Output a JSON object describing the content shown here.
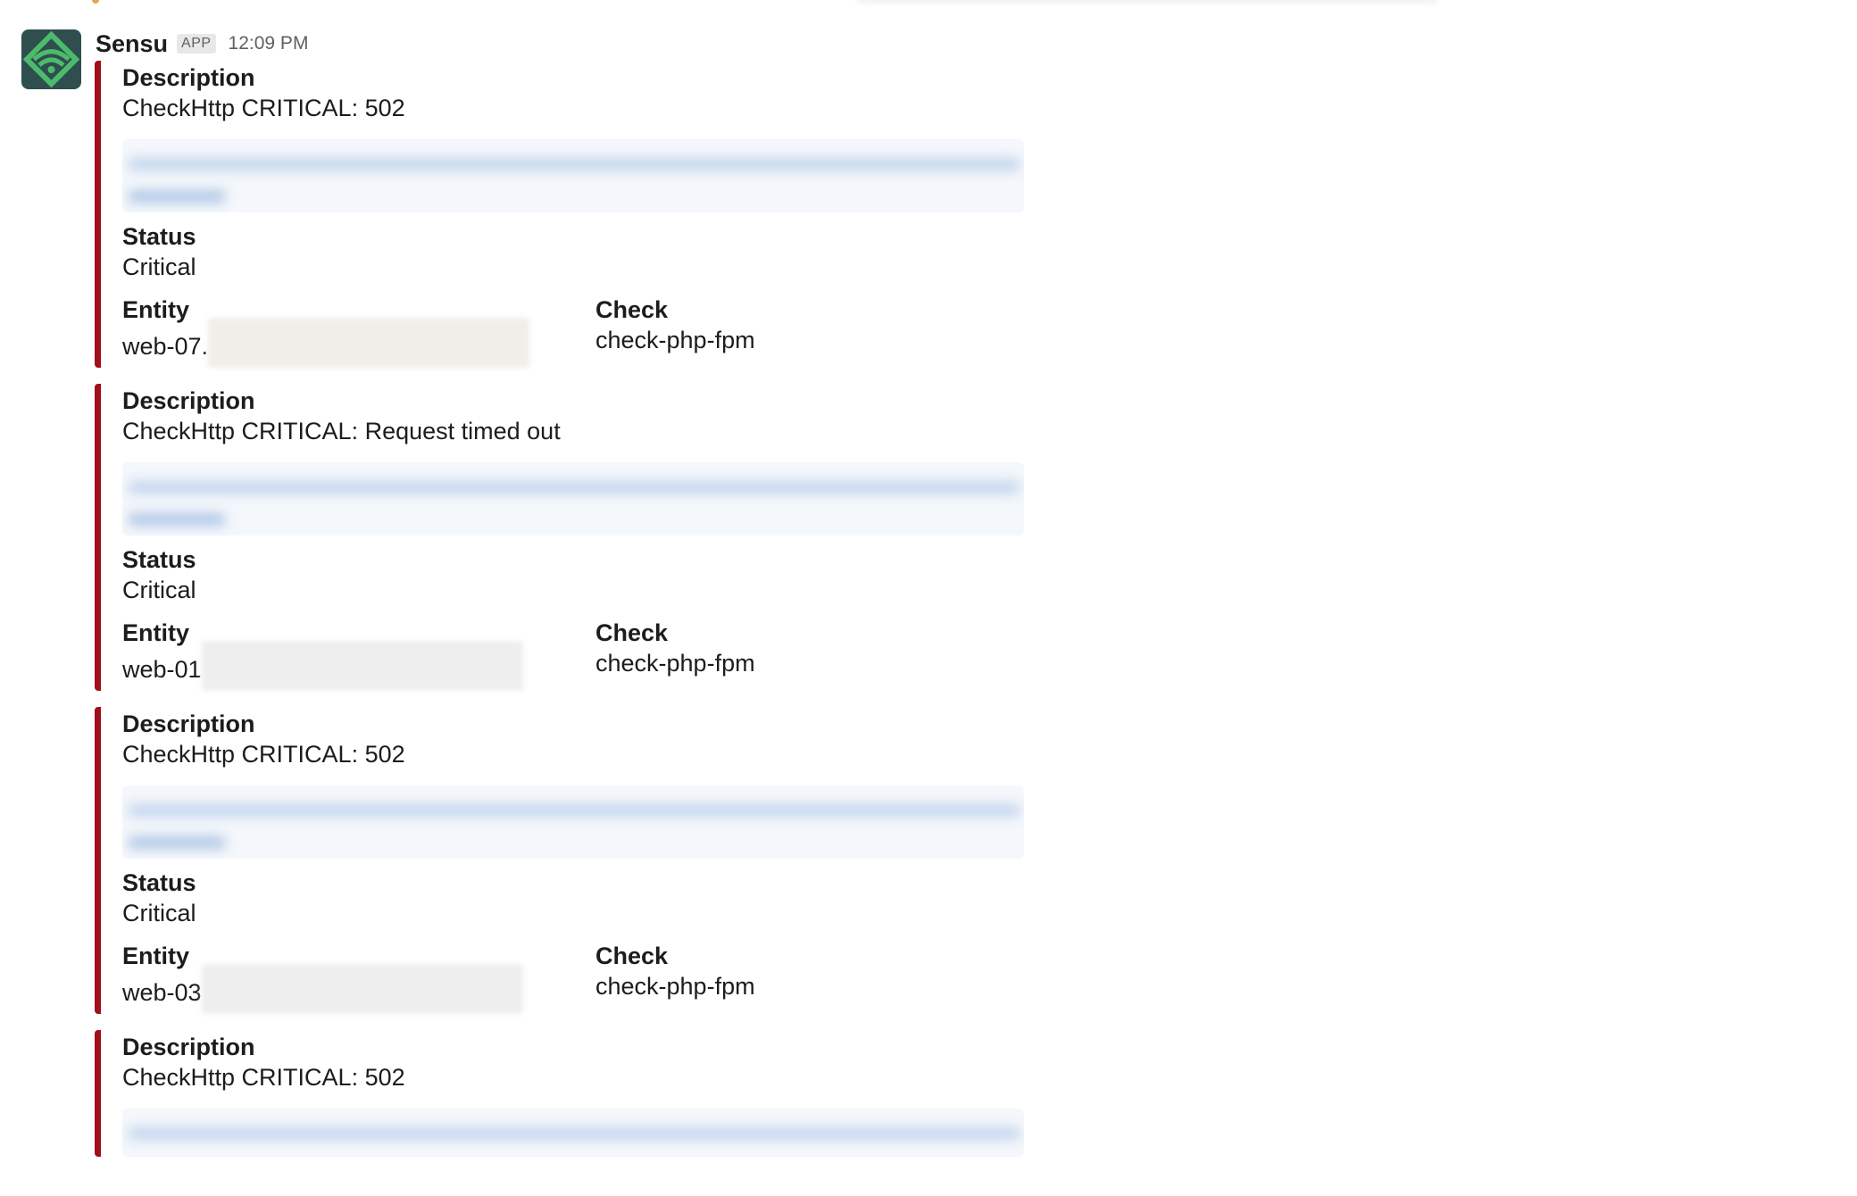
{
  "message": {
    "sender": "Sensu",
    "badge": "APP",
    "time": "12:09 PM"
  },
  "colors": {
    "attachment_bar": "#a00f1a",
    "avatar_bg": "#2f4f4f",
    "avatar_accent": "#4dbb6c"
  },
  "icons": {
    "avatar": "sensu-logo-icon"
  },
  "attachments": [
    {
      "description_label": "Description",
      "description": "CheckHttp CRITICAL: 502",
      "status_label": "Status",
      "status": "Critical",
      "entity_label": "Entity",
      "entity": "web-07.",
      "check_label": "Check",
      "check": "check-php-fpm"
    },
    {
      "description_label": "Description",
      "description": "CheckHttp CRITICAL: Request timed out",
      "status_label": "Status",
      "status": "Critical",
      "entity_label": "Entity",
      "entity": "web-01",
      "check_label": "Check",
      "check": "check-php-fpm"
    },
    {
      "description_label": "Description",
      "description": "CheckHttp CRITICAL: 502",
      "status_label": "Status",
      "status": "Critical",
      "entity_label": "Entity",
      "entity": "web-03",
      "check_label": "Check",
      "check": "check-php-fpm"
    },
    {
      "description_label": "Description",
      "description": "CheckHttp CRITICAL: 502"
    }
  ]
}
